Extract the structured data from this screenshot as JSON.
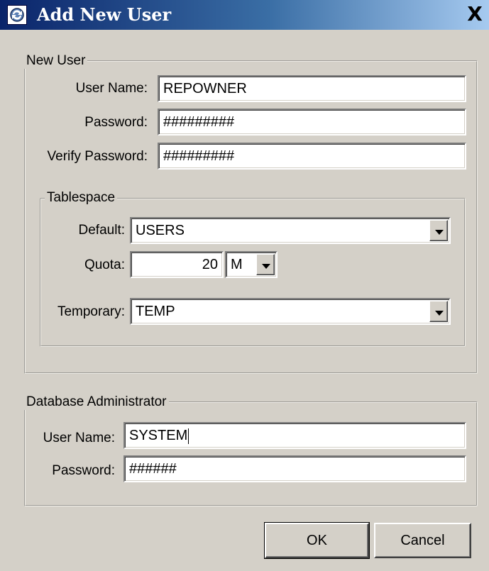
{
  "window": {
    "title": "Add New User",
    "close_label": "X"
  },
  "new_user": {
    "group_label": "New User",
    "user_name_label": "User Name:",
    "user_name_value": "REPOWNER",
    "password_label": "Password:",
    "password_value": "#########",
    "verify_password_label": "Verify Password:",
    "verify_password_value": "#########"
  },
  "tablespace": {
    "group_label": "Tablespace",
    "default_label": "Default:",
    "default_value": "USERS",
    "quota_label": "Quota:",
    "quota_value": "20",
    "quota_unit": "M",
    "temporary_label": "Temporary:",
    "temporary_value": "TEMP"
  },
  "dba": {
    "group_label": "Database Administrator",
    "user_name_label": "User Name:",
    "user_name_value": "SYSTEM",
    "password_label": "Password:",
    "password_value": "######"
  },
  "buttons": {
    "ok_label": "OK",
    "cancel_label": "Cancel"
  }
}
